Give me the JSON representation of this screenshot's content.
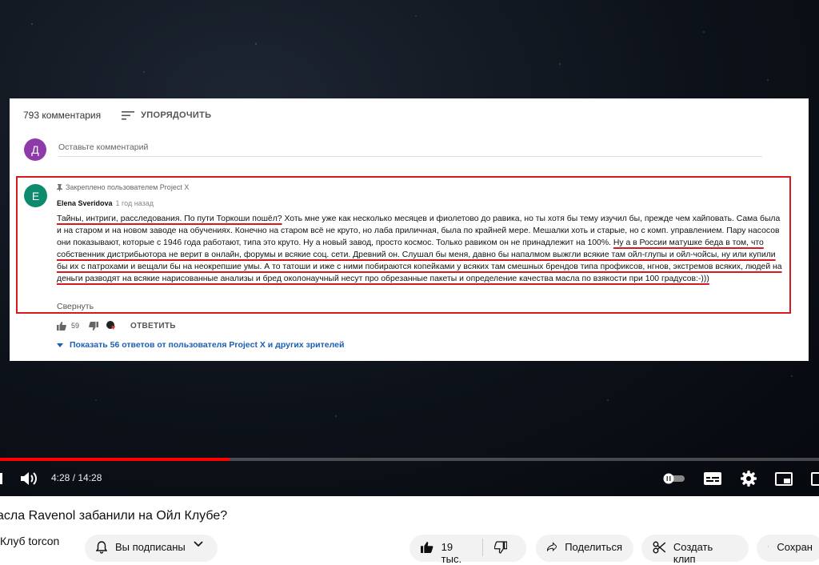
{
  "comments_header": {
    "count": "793 комментария",
    "sort_label": "УПОРЯДОЧИТЬ"
  },
  "add_comment": {
    "avatar_letter": "Д",
    "avatar_color": "#8e3aa8",
    "placeholder": "Оставьте комментарий"
  },
  "comment": {
    "avatar_letter": "E",
    "avatar_color": "#0e8a6e",
    "pinned_text": "Закреплено пользователем Project X",
    "author": "Elena Sveridova",
    "time": "1 год назад",
    "text_parts": [
      "Тайны, интриги, расследования. По пути Торкоши пошёл?",
      " Хоть мне уже как несколько месяцев и фиолетово до равика, но ты хотя бы тему изучил бы, прежде чем хайповать. Сама была и на старом и на новом заводе на обучениях. Конечно на старом всё не круто, но лаба приличная, была по крайней мере. Мешалки хоть и старые, но с комп. управлением. Пару насосов они показывают, которые с 1946 года работают, типа это круто. Ну а новый завод, просто космос. Только равиком он не принадлежит на 100%. ",
      "Ну а в России матушке беда в том, что собственник дистрибьютора не верит в онлайн, форумы и всякие соц. сети. Древний он. Слушал бы меня, давно бы напалмом выжгли всякие там ойл-глупы и ойл-чойсы, ну или купили бы их с патрохами и вещали бы на неокрепшие умы. А то татоши и иже с ними побираются копейками у всяких там смешных брендов типа профиксов, нгнов, экстремов всяких, людей на деньги разводят на всякие нарисованные анализы и бред околонаучный несут про обрезанные пакеты и определение качества масла по взякости при 100 градусов:-)))"
    ],
    "collapse_label": "Свернуть",
    "likes": "59",
    "reply_label": "ОТВЕТИТЬ",
    "replies_label": "Показать 56 ответов от пользователя Project X и других зрителей"
  },
  "player": {
    "progress_fraction": 0.28,
    "time_current": "4:28",
    "time_separator": " / ",
    "time_total": "14:28",
    "accent_color": "#ff0000"
  },
  "video": {
    "title": "асла Ravenol забанили на Ойл Клубе?",
    "channel": "Клуб torcon",
    "subscribe_label": "Вы подписаны",
    "like_count": "19 тыс.",
    "share_label": "Поделиться",
    "clip_label": "Создать клип",
    "save_label": "Сохран"
  }
}
